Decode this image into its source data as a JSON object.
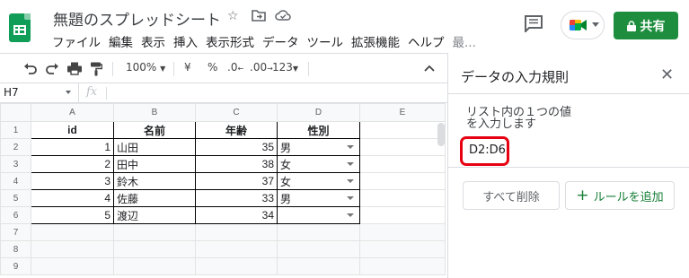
{
  "header": {
    "doc_title": "無題のスプレッドシート",
    "menu": [
      "ファイル",
      "編集",
      "表示",
      "挿入",
      "表示形式",
      "データ",
      "ツール",
      "拡張機能",
      "ヘルプ"
    ],
    "menu_more": "最...",
    "share_label": "共有"
  },
  "toolbar": {
    "zoom": "100%",
    "currency": "¥",
    "percent": "%",
    "dec_less": ".0",
    "dec_more": ".00",
    "format_more": "123"
  },
  "formula": {
    "cell_ref": "H7",
    "fx": "fx"
  },
  "sheet": {
    "columns": [
      "A",
      "B",
      "C",
      "D",
      "E"
    ],
    "rows": [
      "1",
      "2",
      "3",
      "4",
      "5",
      "6",
      "7",
      "8",
      "9"
    ],
    "headers": [
      "id",
      "名前",
      "年齢",
      "性別"
    ],
    "data": [
      {
        "id": "1",
        "name": "山田",
        "age": "35",
        "gender": "男"
      },
      {
        "id": "2",
        "name": "田中",
        "age": "38",
        "gender": "女"
      },
      {
        "id": "3",
        "name": "鈴木",
        "age": "37",
        "gender": "女"
      },
      {
        "id": "4",
        "name": "佐藤",
        "age": "33",
        "gender": "男"
      },
      {
        "id": "5",
        "name": "渡辺",
        "age": "34",
        "gender": ""
      }
    ]
  },
  "panel": {
    "title": "データの入力規則",
    "rule_desc_1": "リスト内の１つの値",
    "rule_desc_2": "を入力します",
    "rule_range": "D2:D6",
    "clear_all": "すべて削除",
    "add_rule": "ルールを追加"
  },
  "colors": {
    "accent_green": "#1e8e3e",
    "highlight_red": "#e60012"
  },
  "icons": [
    "sheets-logo-icon",
    "star-icon",
    "move-folder-icon",
    "cloud-status-icon",
    "comment-icon",
    "meet-icon",
    "lock-icon",
    "undo-icon",
    "redo-icon",
    "print-icon",
    "paint-format-icon",
    "collapse-icon",
    "close-icon",
    "plus-icon"
  ]
}
